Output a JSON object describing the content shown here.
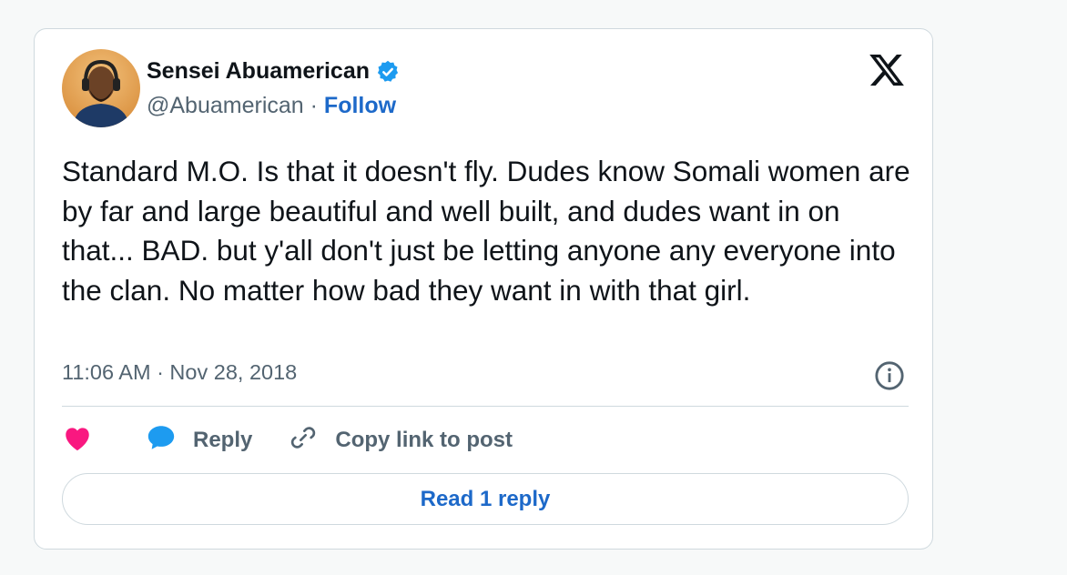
{
  "tweet": {
    "author_name": "Sensei Abuamerican",
    "handle": "@Abuamerican",
    "separator": "·",
    "follow_label": "Follow",
    "text": "Standard M.O. Is that it doesn't fly. Dudes know Somali women are by far and large beautiful and well built, and dudes want in on that... BAD. but y'all don't just be letting anyone any everyone into the clan. No matter how bad they want in with that girl.",
    "timestamp": "11:06 AM · Nov 28, 2018",
    "verified": true
  },
  "actions": {
    "like_icon": "heart-icon",
    "reply_label": "Reply",
    "reply_icon": "speech-bubble-icon",
    "copy_label": "Copy link to post",
    "copy_icon": "link-icon"
  },
  "footer": {
    "read_replies_label": "Read 1 reply"
  },
  "colors": {
    "accent": "#1d9bf0",
    "link": "#1d69c9",
    "like": "#f91880",
    "muted": "#536471",
    "border": "#cfd9de"
  }
}
